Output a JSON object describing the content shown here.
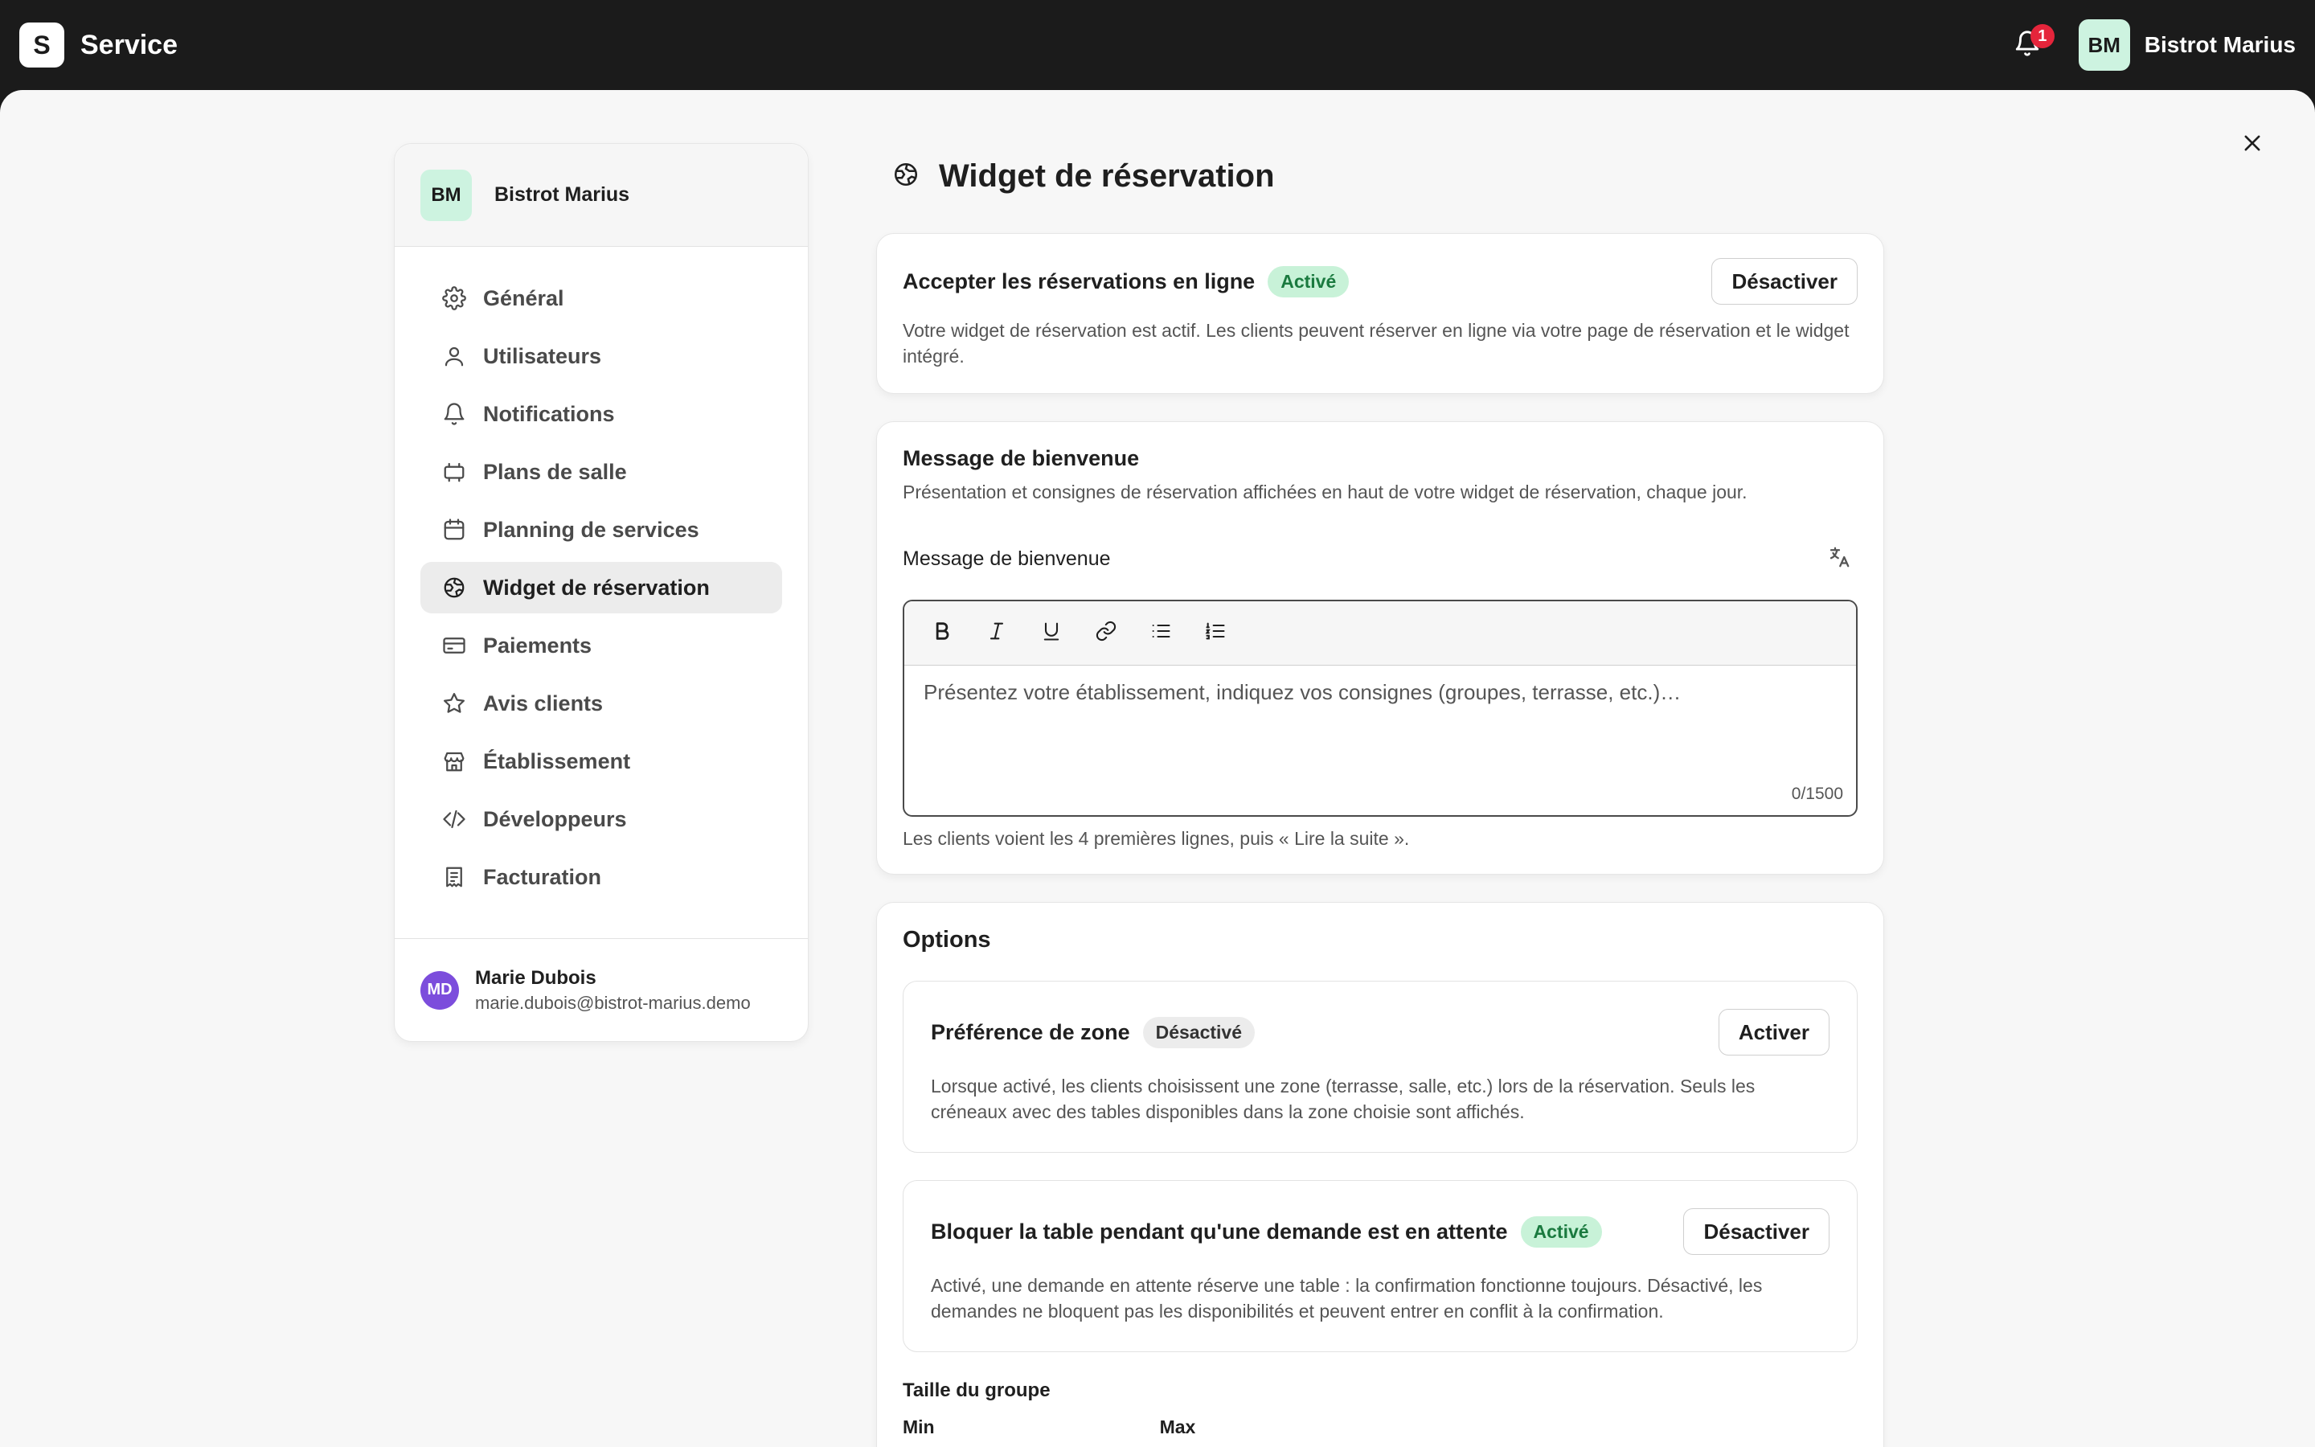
{
  "app": {
    "logo_letter": "S",
    "name": "Service"
  },
  "topbar": {
    "notification_count": "1",
    "avatar_initials": "BM",
    "account_name": "Bistrot Marius"
  },
  "sidebar": {
    "org_initials": "BM",
    "org_name": "Bistrot Marius",
    "items": [
      {
        "label": "Général",
        "icon": "gear-icon"
      },
      {
        "label": "Utilisateurs",
        "icon": "user-icon"
      },
      {
        "label": "Notifications",
        "icon": "bell-icon"
      },
      {
        "label": "Plans de salle",
        "icon": "floor-plan-icon"
      },
      {
        "label": "Planning de services",
        "icon": "calendar-icon"
      },
      {
        "label": "Widget de réservation",
        "icon": "globe-icon"
      },
      {
        "label": "Paiements",
        "icon": "credit-card-icon"
      },
      {
        "label": "Avis clients",
        "icon": "star-icon"
      },
      {
        "label": "Établissement",
        "icon": "store-icon"
      },
      {
        "label": "Développeurs",
        "icon": "code-icon"
      },
      {
        "label": "Facturation",
        "icon": "receipt-icon"
      }
    ],
    "active_index": 5,
    "user": {
      "initials": "MD",
      "name": "Marie Dubois",
      "email": "marie.dubois@bistrot-marius.demo"
    }
  },
  "page": {
    "title": "Widget de réservation"
  },
  "online_booking": {
    "title": "Accepter les réservations en ligne",
    "badge": "Activé",
    "button": "Désactiver",
    "description": "Votre widget de réservation est actif. Les clients peuvent réserver en ligne via votre page de réservation et le widget intégré."
  },
  "welcome": {
    "title": "Message de bienvenue",
    "description": "Présentation et consignes de réservation affichées en haut de votre widget de réservation, chaque jour.",
    "field_label": "Message de bienvenue",
    "placeholder": "Présentez votre établissement, indiquez vos consignes (groupes, terrasse, etc.)…",
    "value": "",
    "counter": "0/1500",
    "helper": "Les clients voient les 4 premières lignes, puis « Lire la suite »."
  },
  "options": {
    "title": "Options",
    "zone": {
      "title": "Préférence de zone",
      "badge": "Désactivé",
      "button": "Activer",
      "description": "Lorsque activé, les clients choisissent une zone (terrasse, salle, etc.) lors de la réservation. Seuls les créneaux avec des tables disponibles dans la zone choisie sont affichés."
    },
    "block_table": {
      "title": "Bloquer la table pendant qu'une demande est en attente",
      "badge": "Activé",
      "button": "Désactiver",
      "description": "Activé, une demande en attente réserve une table : la confirmation fonctionne toujours. Désactivé, les demandes ne bloquent pas les disponibilités et peuvent entrer en conflit à la confirmation."
    },
    "group_size": {
      "title": "Taille du groupe",
      "min_label": "Min",
      "max_label": "Max"
    }
  },
  "colors": {
    "topbar": "#1b1b1b",
    "active_badge_bg": "#c8f2d8",
    "active_badge_text": "#1a7a3f",
    "avatar_bg": "#cdf3e0",
    "user_avatar_bg": "#7c4ddc",
    "notification_badge": "#e5253b"
  }
}
